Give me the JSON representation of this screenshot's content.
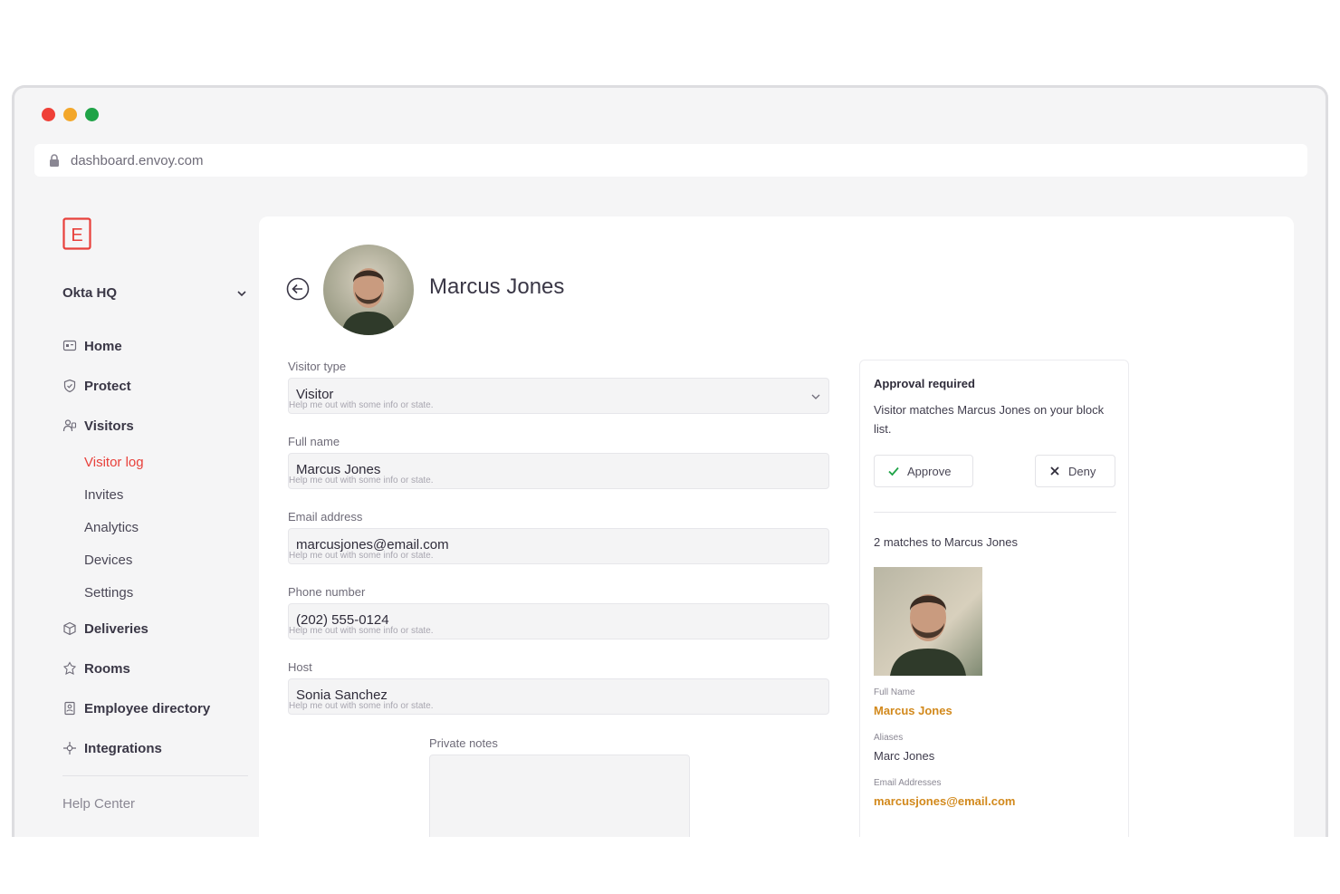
{
  "window": {
    "dot_colors": [
      "#ef4038",
      "#f3a72a",
      "#1fa347"
    ]
  },
  "urlbar": {
    "url": "dashboard.envoy.com",
    "icon": "lock-icon"
  },
  "sidebar": {
    "logo_letter": "E",
    "location": "Okta HQ",
    "nav": [
      {
        "label": "Home",
        "icon": "home-icon"
      },
      {
        "label": "Protect",
        "icon": "shield-icon"
      },
      {
        "label": "Visitors",
        "icon": "visitors-icon"
      }
    ],
    "visitor_subnav": [
      "Visitor log",
      "Invites",
      "Analytics",
      "Devices",
      "Settings"
    ],
    "nav2": [
      {
        "label": "Deliveries",
        "icon": "package-icon"
      },
      {
        "label": "Rooms",
        "icon": "rooms-icon"
      },
      {
        "label": "Employee directory",
        "icon": "directory-icon"
      },
      {
        "label": "Integrations",
        "icon": "integrations-icon"
      }
    ],
    "help": "Help Center",
    "accent": "#e8403b"
  },
  "profile": {
    "name": "Marcus Jones"
  },
  "form": {
    "fields": [
      {
        "label": "Visitor type",
        "value": "Visitor",
        "help": "Help me out with some info or state."
      },
      {
        "label": "Full name",
        "value": "Marcus Jones",
        "help": "Help me out with some info or state."
      },
      {
        "label": "Email address",
        "value": "marcusjones@email.com",
        "help": "Help me out with some info or state."
      },
      {
        "label": "Phone number",
        "value": "(202) 555-0124",
        "help": "Help me out with some info or state."
      },
      {
        "label": "Host",
        "value": "Sonia Sanchez",
        "help": "Help me out with some info or state."
      }
    ],
    "notes_label": "Private notes"
  },
  "approval": {
    "title": "Approval required",
    "text": "Visitor matches Marcus Jones on your block list.",
    "approve": "Approve",
    "deny": "Deny",
    "matches": "2 matches to Marcus Jones",
    "full_name_label": "Full Name",
    "full_name": "Marcus Jones",
    "aliases_label": "Aliases",
    "aliases": "Marc Jones",
    "email_label": "Email Addresses",
    "email": "marcusjones@email.com",
    "highlight": "#d2891c"
  }
}
